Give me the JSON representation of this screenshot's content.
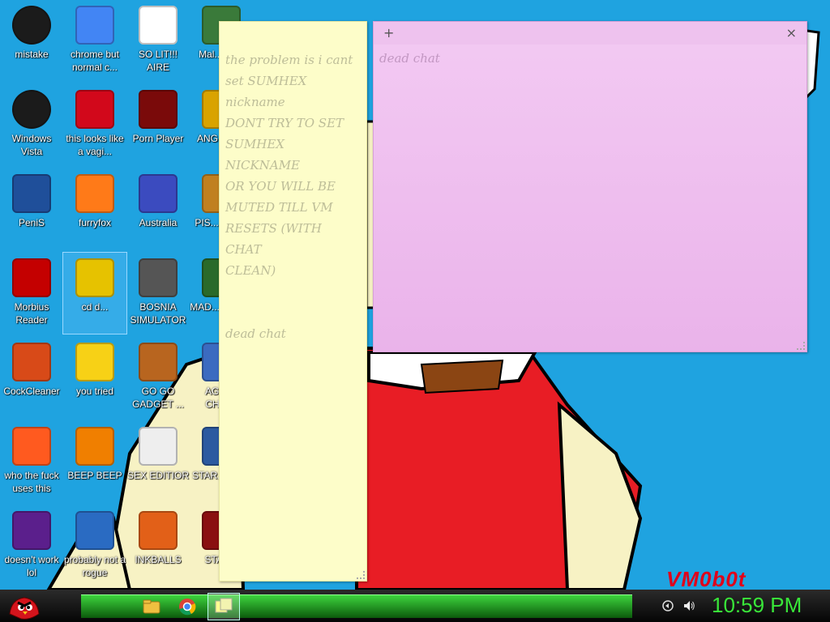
{
  "desktop": {
    "icons": [
      {
        "label": "mistake"
      },
      {
        "label": "chrome but normal c..."
      },
      {
        "label": "SO LIT!!! AIRE"
      },
      {
        "label": "Mal... By..."
      },
      {
        "label": "Windows Vista"
      },
      {
        "label": "this looks like a vagi..."
      },
      {
        "label": "Porn Player"
      },
      {
        "label": "ANG... Bl..."
      },
      {
        "label": "PeniS"
      },
      {
        "label": "furryfox"
      },
      {
        "label": "Australia"
      },
      {
        "label": "PIS... OFF..."
      },
      {
        "label": "Morbius Reader"
      },
      {
        "label": "cd d..."
      },
      {
        "label": "BOSNIA SIMULATOR"
      },
      {
        "label": "MAD... UNIV..."
      },
      {
        "label": "CockCleaner"
      },
      {
        "label": "you tried"
      },
      {
        "label": "GO GO GADGET ..."
      },
      {
        "label": "AGGI... CHIC..."
      },
      {
        "label": "who the fuck uses this"
      },
      {
        "label": "BEEP BEEP"
      },
      {
        "label": "SEX EDITIOR"
      },
      {
        "label": "STAR... GA..."
      },
      {
        "label": "doesn't work lol"
      },
      {
        "label": "probably not a rogue"
      },
      {
        "label": "INKBALLS"
      },
      {
        "label": "STAR..."
      }
    ]
  },
  "notes": {
    "yellow": {
      "text": "the problem is i cant\nset SUMHEX\nnickname\nDONT TRY TO SET\nSUMHEX NICKNAME\nOR YOU WILL BE\nMUTED TILL VM\nRESETS (WITH CHAT\nCLEAN)\n\n\ndead chat"
    },
    "pink": {
      "add_label": "+",
      "close_label": "×",
      "text": "dead chat"
    }
  },
  "watermark": "VM0b0t",
  "taskbar": {
    "clock": "10:59 PM"
  },
  "icon_names": [
    "start-orb-icon",
    "folder-icon",
    "chrome-icon",
    "sticky-notes-icon",
    "network-icon",
    "volume-icon"
  ]
}
